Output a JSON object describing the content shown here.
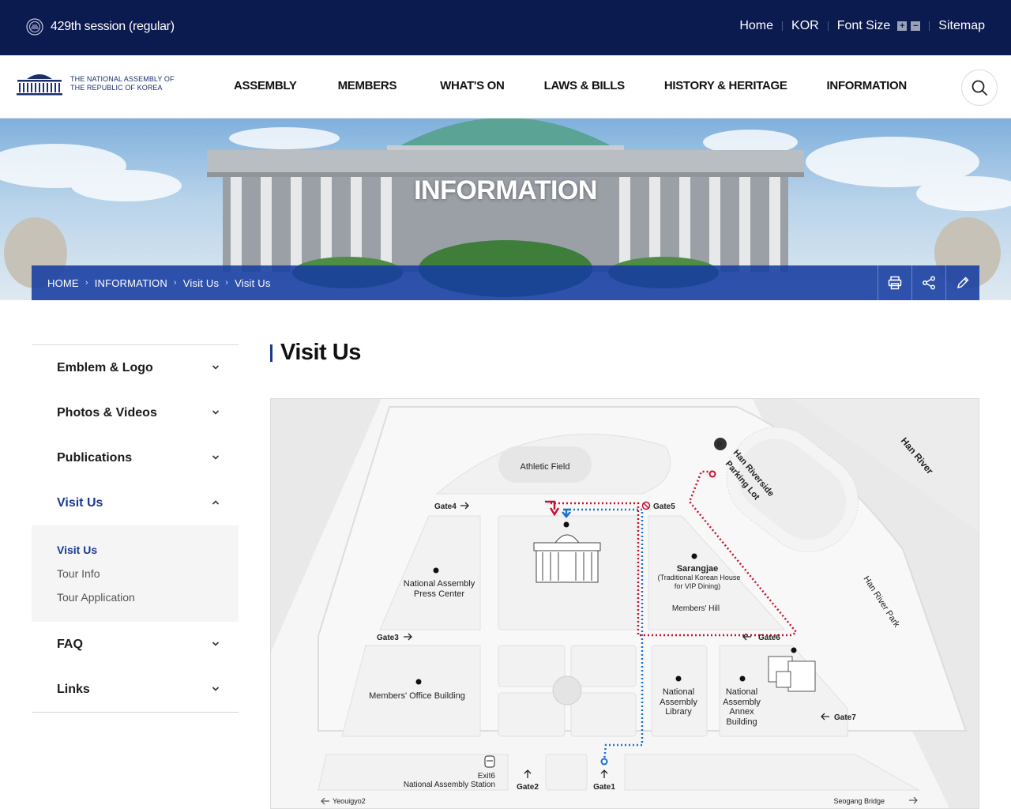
{
  "topbar": {
    "session": "429th session (regular)",
    "links": {
      "home": "Home",
      "kor": "KOR",
      "font_size": "Font Size",
      "sitemap": "Sitemap"
    }
  },
  "logo": {
    "line1": "THE NATIONAL ASSEMBLY OF",
    "line2": "THE REPUBLIC OF KOREA"
  },
  "nav": [
    "ASSEMBLY",
    "MEMBERS",
    "WHAT'S ON",
    "LAWS & BILLS",
    "HISTORY & HERITAGE",
    "INFORMATION"
  ],
  "hero": {
    "title": "INFORMATION"
  },
  "breadcrumb": [
    "HOME",
    "INFORMATION",
    "Visit Us",
    "Visit Us"
  ],
  "sidebar": {
    "items": [
      {
        "label": "Emblem & Logo"
      },
      {
        "label": "Photos & Videos"
      },
      {
        "label": "Publications"
      },
      {
        "label": "Visit Us"
      },
      {
        "label": "FAQ"
      },
      {
        "label": "Links"
      }
    ],
    "sub_items": [
      "Visit Us",
      "Tour Info",
      "Tour Application"
    ]
  },
  "page": {
    "title": "Visit Us"
  },
  "map": {
    "athletic_field": "Athletic Field",
    "gates": {
      "g1": "Gate1",
      "g2": "Gate2",
      "g3": "Gate3",
      "g4": "Gate4",
      "g5": "Gate5",
      "g6": "Gate6",
      "g7": "Gate7"
    },
    "parking_1": "Han Riverside",
    "parking_2": "Parking Lot",
    "han_river": "Han River",
    "han_river_park": "Han River Park",
    "press_1": "National Assembly",
    "press_2": "Press Center",
    "sarang_1": "Sarangjae",
    "sarang_2": "(Traditional Korean House",
    "sarang_3": "for VIP Dining)",
    "members_hill": "Members' Hill",
    "office": "Members' Office Building",
    "library_1": "National",
    "library_2": "Assembly",
    "library_3": "Library",
    "annex_1": "National",
    "annex_2": "Assembly",
    "annex_3": "Annex",
    "annex_4": "Building",
    "exit6": "Exit6",
    "station": "National Assembly Station",
    "yeouigyo": "Yeouigyo2",
    "seogang": "Seogang Bridge",
    "colors": {
      "red_route": "#c8102e",
      "blue_route": "#1a6fd1"
    }
  }
}
